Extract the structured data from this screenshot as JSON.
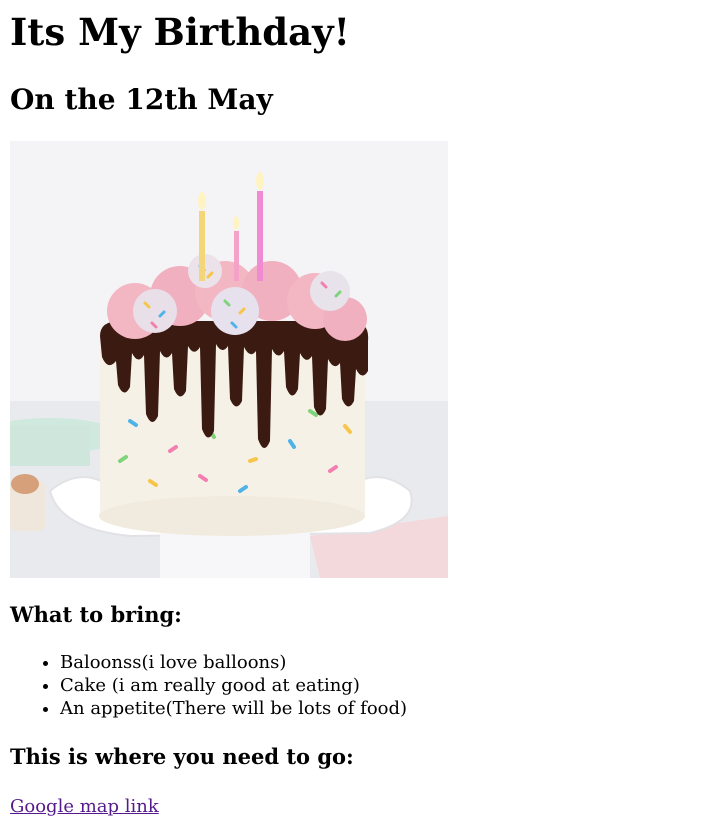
{
  "heading": "Its My Birthday!",
  "subheading": "On the 12th May",
  "bring_heading": "What to bring:",
  "bring_items": [
    "Baloonss(i love balloons)",
    "Cake (i am really good at eating)",
    "An appetite(There will be lots of food)"
  ],
  "location_heading": "This is where you need to go:",
  "map_link_label": "Google map link",
  "colors": {
    "link_visited": "#551a8b",
    "chocolate": "#3b1a12",
    "frosting": "#f3b7c4",
    "cake_body": "#f6f1e6"
  }
}
